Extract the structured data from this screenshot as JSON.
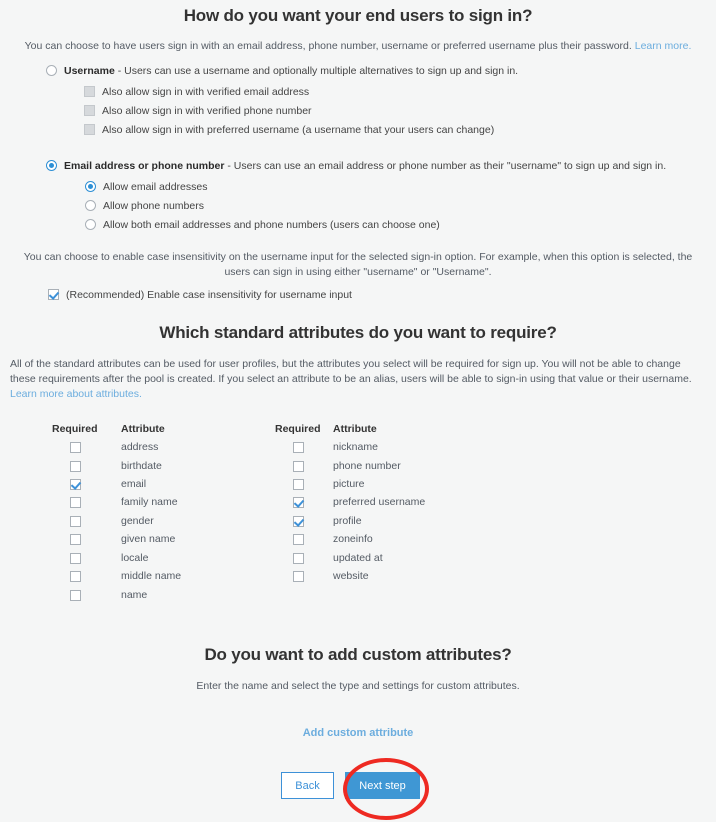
{
  "signin": {
    "title": "How do you want your end users to sign in?",
    "intro": "You can choose to have users sign in with an email address, phone number, username or preferred username plus their password.",
    "intro_link": "Learn more.",
    "username_option": {
      "label": "Username",
      "description": " - Users can use a username and optionally multiple alternatives to sign up and sign in.",
      "selected": false,
      "suboptions": [
        {
          "label": "Also allow sign in with verified email address",
          "checked": false
        },
        {
          "label": "Also allow sign in with verified phone number",
          "checked": false
        },
        {
          "label": "Also allow sign in with preferred username (a username that your users can change)",
          "checked": false
        }
      ]
    },
    "email_option": {
      "label": "Email address or phone number",
      "description": " - Users can use an email address or phone number as their \"username\" to sign up and sign in.",
      "selected": true,
      "suboptions": [
        {
          "label": "Allow email addresses",
          "selected": true
        },
        {
          "label": "Allow phone numbers",
          "selected": false
        },
        {
          "label": "Allow both email addresses and phone numbers (users can choose one)",
          "selected": false
        }
      ]
    },
    "case_paragraph": "You can choose to enable case insensitivity on the username input for the selected sign-in option. For example, when this option is selected, the users can sign in using either \"username\" or \"Username\".",
    "case_checkbox": {
      "label": "(Recommended) Enable case insensitivity for username input",
      "checked": true
    }
  },
  "attributes": {
    "title": "Which standard attributes do you want to require?",
    "paragraph": "All of the standard attributes can be used for user profiles, but the attributes you select will be required for sign up. You will not be able to change these requirements after the pool is created. If you select an attribute to be an alias, users will be able to sign-in using that value or their username.",
    "paragraph_link": "Learn more about attributes.",
    "headers": {
      "required": "Required",
      "attribute": "Attribute"
    },
    "left_column": [
      {
        "name": "address",
        "checked": false
      },
      {
        "name": "birthdate",
        "checked": false
      },
      {
        "name": "email",
        "checked": true
      },
      {
        "name": "family name",
        "checked": false
      },
      {
        "name": "gender",
        "checked": false
      },
      {
        "name": "given name",
        "checked": false
      },
      {
        "name": "locale",
        "checked": false
      },
      {
        "name": "middle name",
        "checked": false
      },
      {
        "name": "name",
        "checked": false
      }
    ],
    "right_column": [
      {
        "name": "nickname",
        "checked": false
      },
      {
        "name": "phone number",
        "checked": false
      },
      {
        "name": "picture",
        "checked": false
      },
      {
        "name": "preferred username",
        "checked": true
      },
      {
        "name": "profile",
        "checked": true
      },
      {
        "name": "zoneinfo",
        "checked": false
      },
      {
        "name": "updated at",
        "checked": false
      },
      {
        "name": "website",
        "checked": false
      }
    ]
  },
  "custom": {
    "title": "Do you want to add custom attributes?",
    "subtitle": "Enter the name and select the type and settings for custom attributes.",
    "add_link": "Add custom attribute"
  },
  "footer": {
    "back_label": "Back",
    "next_label": "Next step"
  },
  "colors": {
    "accent": "#3f97d4",
    "link": "#6cadde",
    "annotation": "#ee2a22",
    "background": "#f5f6f6"
  }
}
